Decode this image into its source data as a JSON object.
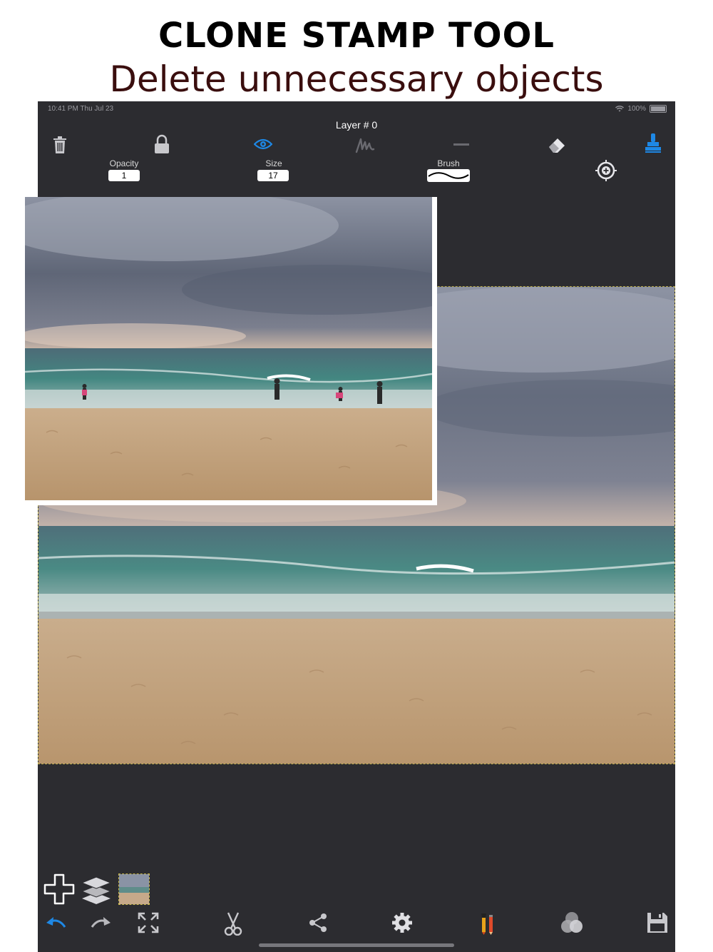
{
  "promo": {
    "title": "CLONE STAMP TOOL",
    "subtitle": "Delete unnecessary objects"
  },
  "status_bar": {
    "time": "10:41 PM  Thu Jul 23",
    "battery": "100%"
  },
  "header": {
    "layer_title": "Layer # 0"
  },
  "controls": {
    "opacity_label": "Opacity",
    "opacity_value": "1",
    "size_label": "Size",
    "size_value": "17",
    "brush_label": "Brush"
  },
  "icons": {
    "top": [
      "trash-icon",
      "lock-icon",
      "eye-icon",
      "pen-icon",
      "minus-icon",
      "eraser-icon",
      "stamp-icon",
      "crosshair-icon"
    ],
    "layer_controls": [
      "add-icon",
      "layers-icon",
      "layer-thumbnail"
    ],
    "bottom": [
      "undo-icon",
      "redo-icon",
      "fit-screen-icon",
      "scissors-icon",
      "share-icon",
      "gear-icon",
      "paint-tools-icon",
      "blend-icon",
      "save-icon"
    ]
  },
  "colors": {
    "background": "#2c2c30",
    "accent_blue": "#1e88e5",
    "icon_gray": "#c8c8cc"
  }
}
